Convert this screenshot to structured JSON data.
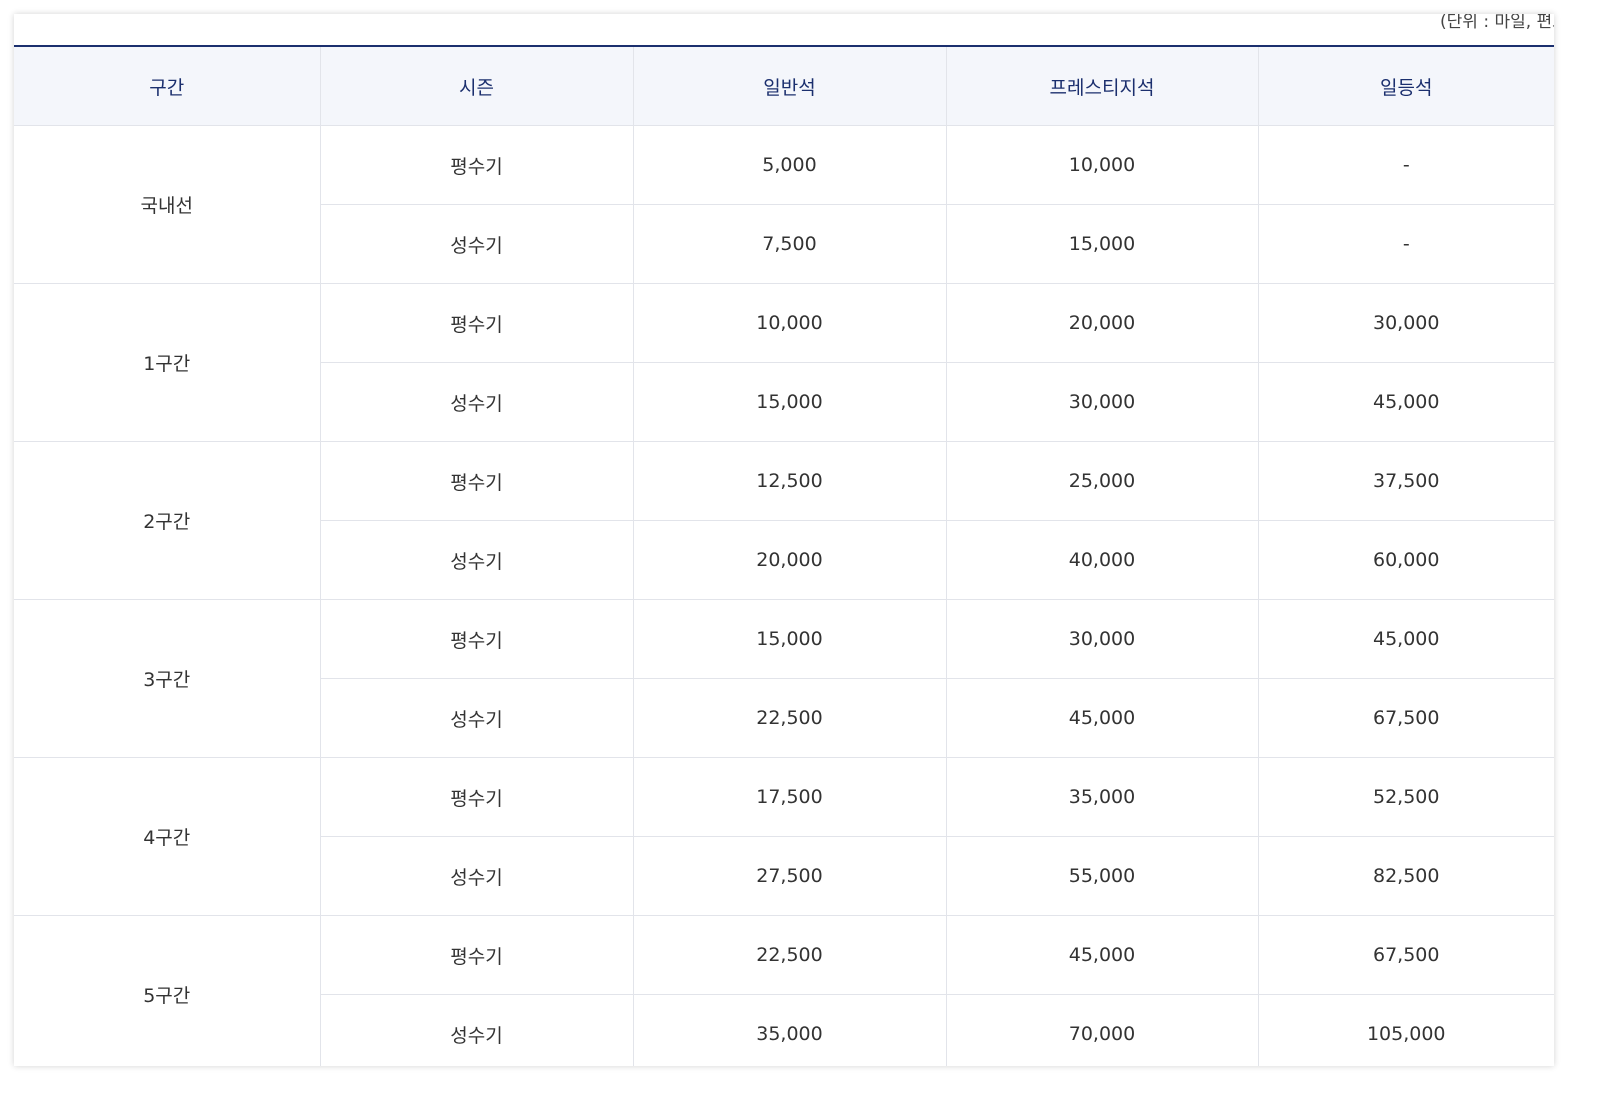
{
  "unit_note": "(단위 : 마일, 편도",
  "table": {
    "headers": [
      "구간",
      "시즌",
      "일반석",
      "프레스티지석",
      "일등석"
    ],
    "rows": [
      {
        "section": "국내선",
        "seasons": [
          {
            "season": "평수기",
            "economy": "5,000",
            "prestige": "10,000",
            "first": "-"
          },
          {
            "season": "성수기",
            "economy": "7,500",
            "prestige": "15,000",
            "first": "-"
          }
        ]
      },
      {
        "section": "1구간",
        "seasons": [
          {
            "season": "평수기",
            "economy": "10,000",
            "prestige": "20,000",
            "first": "30,000"
          },
          {
            "season": "성수기",
            "economy": "15,000",
            "prestige": "30,000",
            "first": "45,000"
          }
        ]
      },
      {
        "section": "2구간",
        "seasons": [
          {
            "season": "평수기",
            "economy": "12,500",
            "prestige": "25,000",
            "first": "37,500"
          },
          {
            "season": "성수기",
            "economy": "20,000",
            "prestige": "40,000",
            "first": "60,000"
          }
        ]
      },
      {
        "section": "3구간",
        "seasons": [
          {
            "season": "평수기",
            "economy": "15,000",
            "prestige": "30,000",
            "first": "45,000"
          },
          {
            "season": "성수기",
            "economy": "22,500",
            "prestige": "45,000",
            "first": "67,500"
          }
        ]
      },
      {
        "section": "4구간",
        "seasons": [
          {
            "season": "평수기",
            "economy": "17,500",
            "prestige": "35,000",
            "first": "52,500"
          },
          {
            "season": "성수기",
            "economy": "27,500",
            "prestige": "55,000",
            "first": "82,500"
          }
        ]
      },
      {
        "section": "5구간",
        "seasons": [
          {
            "season": "평수기",
            "economy": "22,500",
            "prestige": "45,000",
            "first": "67,500"
          },
          {
            "season": "성수기",
            "economy": "35,000",
            "prestige": "70,000",
            "first": "105,000"
          }
        ]
      }
    ]
  },
  "colors": {
    "header_background": "#f4f6fb",
    "header_text": "#1b2f6e",
    "top_rule": "#1b2f6e",
    "cell_border": "#e2e4ea",
    "body_text": "#333333"
  }
}
